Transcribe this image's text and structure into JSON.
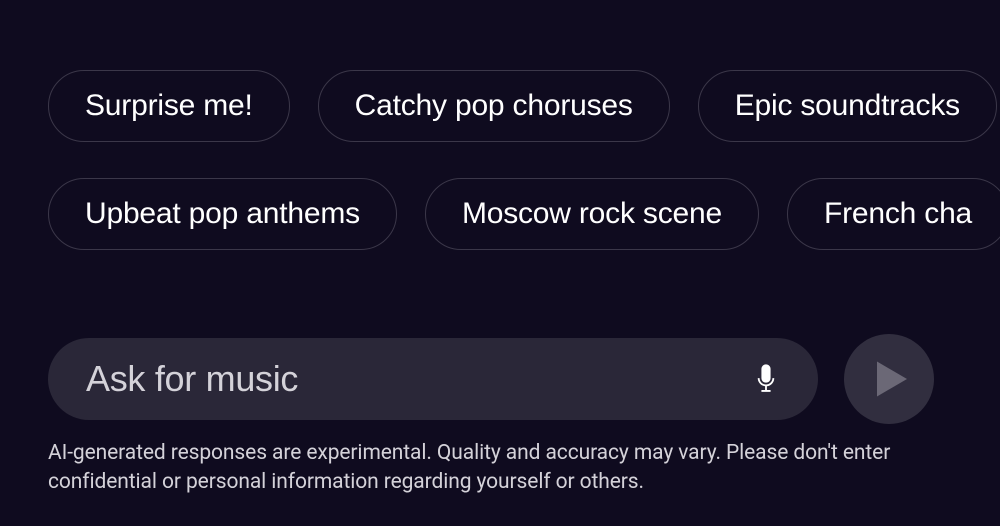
{
  "suggestions": {
    "row1": [
      "Surprise me!",
      "Catchy pop choruses",
      "Epic soundtracks"
    ],
    "row2": [
      "Upbeat pop anthems",
      "Moscow rock scene",
      "French cha"
    ]
  },
  "input": {
    "placeholder": "Ask for music",
    "value": ""
  },
  "disclaimer": "AI-generated responses are experimental. Quality and accuracy may vary. Please don't enter confidential or personal information regarding yourself or others."
}
